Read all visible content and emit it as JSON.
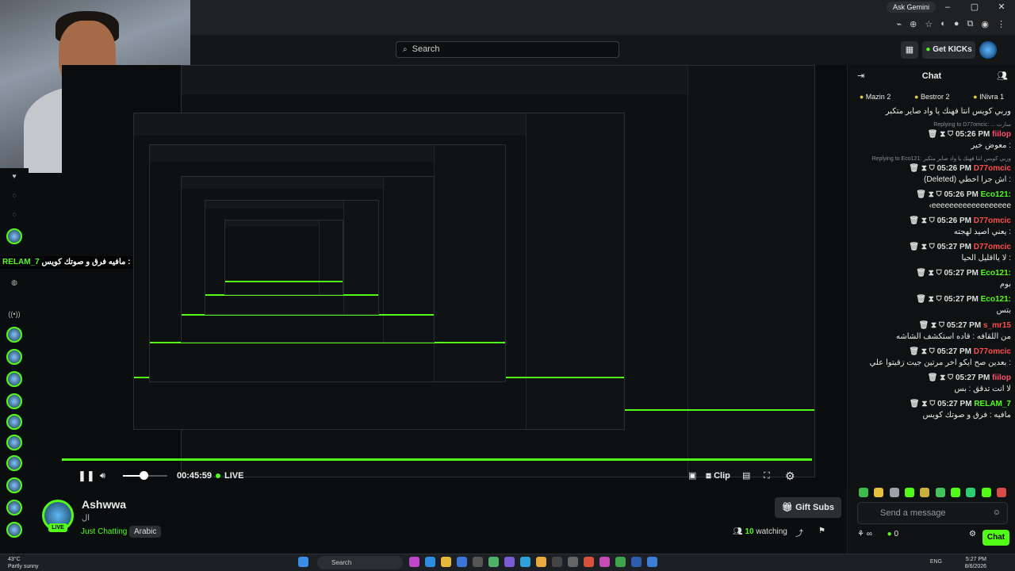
{
  "browser": {
    "ask_gemini": "Ask Gemini",
    "window_buttons": [
      "–",
      "▢",
      "✕"
    ]
  },
  "header": {
    "search_placeholder": "Search",
    "get_kicks": "Get KICKs"
  },
  "overlay": {
    "user": "RELAM_7",
    "text": "مافيه فرق و صوتك كويس :"
  },
  "player": {
    "time": "00:45:59",
    "live": "LIVE",
    "clip": "Clip"
  },
  "stream_info": {
    "streamer": "Ashwwa",
    "subtitle": "ال",
    "category": "Just Chatting",
    "language": "Arabic",
    "gift_subs": "Gift Subs",
    "viewers": "10",
    "watching_label": "watching",
    "live_badge": "LIVE"
  },
  "chat": {
    "title": "Chat",
    "gifters": [
      {
        "name": "Mazin",
        "count": "2"
      },
      {
        "name": "Bestror",
        "count": "2"
      },
      {
        "name": "INivra",
        "count": "1"
      }
    ],
    "messages": [
      {
        "reply": "",
        "meta": "",
        "user": "",
        "user_color": "#eaeaea",
        "text": "وربي كويس انتا فهنك يا واد صاير متكبر"
      },
      {
        "reply": "Replying to D77omcic: ... سارت",
        "meta": "05:26 PM",
        "user": "fiilop",
        "user_color": "#ff4d6d",
        "text": "معوض خير :"
      },
      {
        "reply": "Replying to Eco121: وربي كويس انتا فهنك يا واد صاير متكبر",
        "meta": "05:26 PM",
        "user": "D77omcic",
        "user_color": "#ff4d4d",
        "text": "(Deleted) اش جرا اخطي :"
      },
      {
        "reply": "",
        "meta": "05:26 PM",
        "user": "Eco121:",
        "user_color": "#53fc18",
        "text": "‹eeeeeeeeeeeeeeeeee"
      },
      {
        "reply": "",
        "meta": "05:26 PM",
        "user": "D77omcic",
        "user_color": "#ff4d4d",
        "text": "يعني اصيد لهجته :"
      },
      {
        "reply": "",
        "meta": "05:27 PM",
        "user": "D77omcic",
        "user_color": "#ff4d4d",
        "text": "لا يااقليل الحيا :"
      },
      {
        "reply": "",
        "meta": "05:27 PM",
        "user": "Eco121:",
        "user_color": "#53fc18",
        "text": "بوم"
      },
      {
        "reply": "",
        "meta": "05:27 PM",
        "user": "Eco121:",
        "user_color": "#53fc18",
        "text": "بتس"
      },
      {
        "reply": "",
        "meta": "05:27 PM",
        "user": "s_mr15",
        "user_color": "#ff4d4d",
        "text": "من اللقافه : قاده استكشف الشاشه"
      },
      {
        "reply": "",
        "meta": "05:27 PM",
        "user": "D77omcic",
        "user_color": "#ff4d4d",
        "text": "بعدين صح ايكو اخر مرتين جيت زقيتوا علي :"
      },
      {
        "reply": "",
        "meta": "05:27 PM",
        "user": "fiilop",
        "user_color": "#ff4d6d",
        "text": "لا انت تدقق : بس"
      },
      {
        "reply": "",
        "meta": "05:27 PM",
        "user": "RELAM_7",
        "user_color": "#53fc18",
        "text": "مافيه : فرق و صوتك كويس"
      }
    ],
    "send_placeholder": "Send a message",
    "points": "0",
    "chat_button": "Chat"
  },
  "taskbar": {
    "weather_temp": "43°C",
    "weather_desc": "Partly sunny",
    "search": "Search",
    "lang": "ENG",
    "time": "5:27 PM",
    "date": "8/6/2026"
  }
}
